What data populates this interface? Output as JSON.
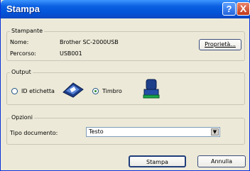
{
  "window": {
    "title": "Stampa",
    "help_label": "?",
    "close_label": "X"
  },
  "stampante": {
    "legend": "Stampante",
    "name_label": "Nome:",
    "name_value": "Brother SC-2000USB",
    "path_label": "Percorso:",
    "path_value": "USB001",
    "properties_button": "Proprietà..."
  },
  "output": {
    "legend": "Output",
    "options": [
      {
        "label": "ID etichetta",
        "selected": false,
        "icon": "id-label-icon"
      },
      {
        "label": "Timbro",
        "selected": true,
        "icon": "stamp-icon"
      }
    ]
  },
  "opzioni": {
    "legend": "Opzioni",
    "doc_type_label": "Tipo documento:",
    "doc_type_value": "Testo"
  },
  "footer": {
    "print_button": "Stampa",
    "cancel_button": "Annulla"
  }
}
